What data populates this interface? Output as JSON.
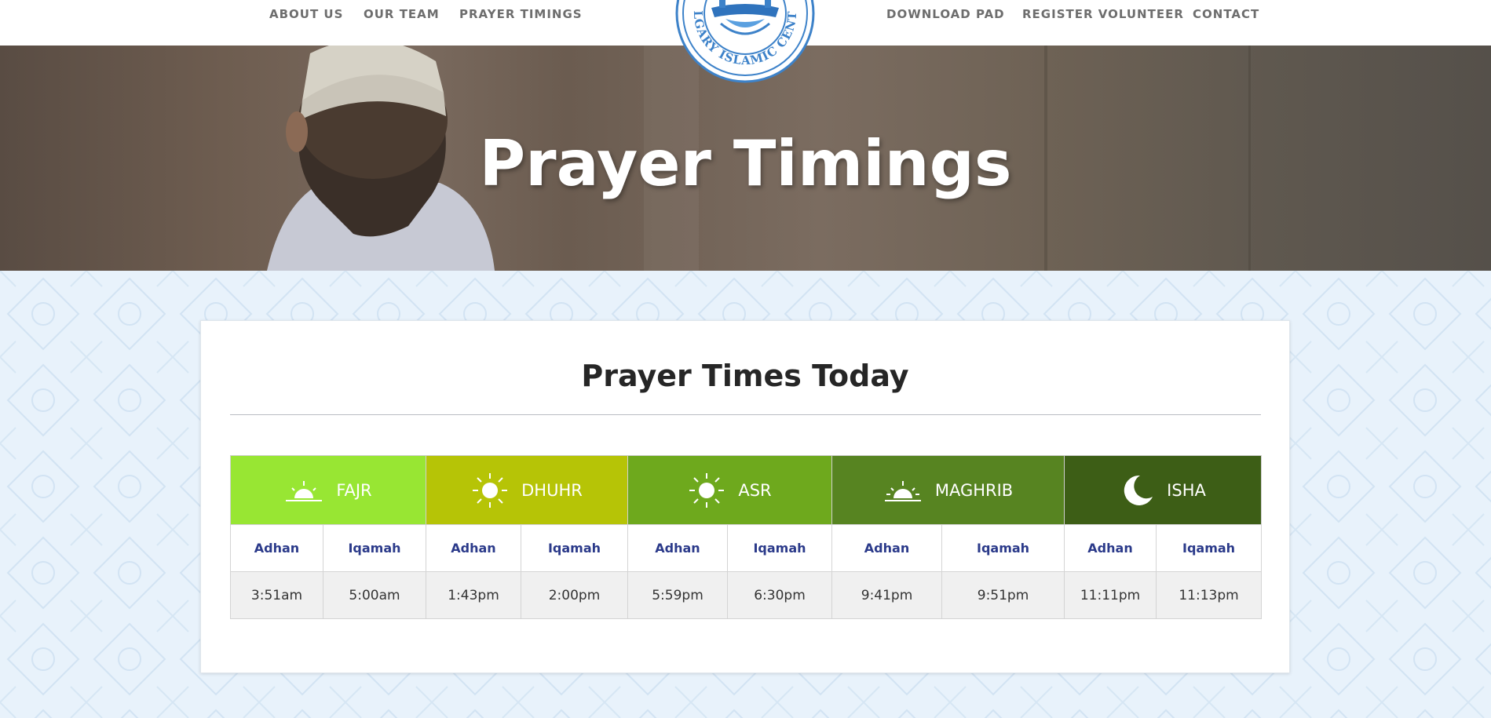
{
  "nav": {
    "left": [
      "ABOUT US",
      "OUR TEAM",
      "PRAYER TIMINGS"
    ],
    "right": [
      "DOWNLOAD PAD",
      "REGISTER VOLUNTEER",
      "CONTACT"
    ]
  },
  "logo": {
    "text": "CALGARY ISLAMIC CENTRE",
    "icon": "mosque-logo"
  },
  "hero": {
    "title": "Prayer Timings"
  },
  "card": {
    "title": "Prayer Times Today",
    "prayers": [
      {
        "name": "FAJR",
        "icon": "sunrise-icon",
        "color": "#98e633",
        "adhan_label": "Adhan",
        "iqamah_label": "Iqamah",
        "adhan": "3:51am",
        "iqamah": "5:00am"
      },
      {
        "name": "DHUHR",
        "icon": "sun-icon",
        "color": "#b6c406",
        "adhan_label": "Adhan",
        "iqamah_label": "Iqamah",
        "adhan": "1:43pm",
        "iqamah": "2:00pm"
      },
      {
        "name": "ASR",
        "icon": "sun-icon",
        "color": "#6ea91d",
        "adhan_label": "Adhan",
        "iqamah_label": "Iqamah",
        "adhan": "5:59pm",
        "iqamah": "6:30pm"
      },
      {
        "name": "MAGHRIB",
        "icon": "sunset-icon",
        "color": "#578421",
        "adhan_label": "Adhan",
        "iqamah_label": "Iqamah",
        "adhan": "9:41pm",
        "iqamah": "9:51pm"
      },
      {
        "name": "ISHA",
        "icon": "moon-icon",
        "color": "#3d5e16",
        "adhan_label": "Adhan",
        "iqamah_label": "Iqamah",
        "adhan": "11:11pm",
        "iqamah": "11:13pm"
      }
    ]
  },
  "colors": {
    "nav_text": "#6d6d6d",
    "label_text": "#2b3a8a",
    "background": "#e6f1fa",
    "logo_blue": "#3d82c9"
  }
}
